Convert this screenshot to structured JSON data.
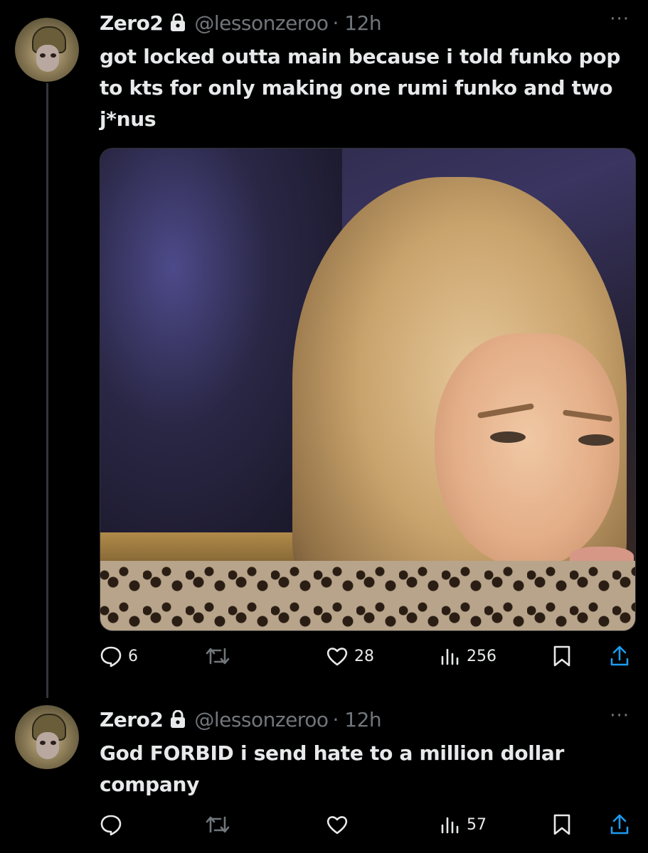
{
  "tweets": [
    {
      "name": "Zero2",
      "handle": "@lessonzeroo",
      "time": "· 12h",
      "text": "got locked outta main because i told funko pop to kts for only making one rumi funko and two j*nus",
      "metrics": {
        "replies": "6",
        "reposts": "",
        "likes": "28",
        "views": "256"
      }
    },
    {
      "name": "Zero2",
      "handle": "@lessonzeroo",
      "time": "· 12h",
      "text": "God FORBID i send hate to a million dollar company",
      "metrics": {
        "replies": "",
        "reposts": "",
        "likes": "",
        "views": "57"
      }
    }
  ],
  "more_label": "···",
  "colors": {
    "background": "#000000",
    "text": "#e7e9ea",
    "muted": "#71767b",
    "thread_line": "#333639"
  }
}
